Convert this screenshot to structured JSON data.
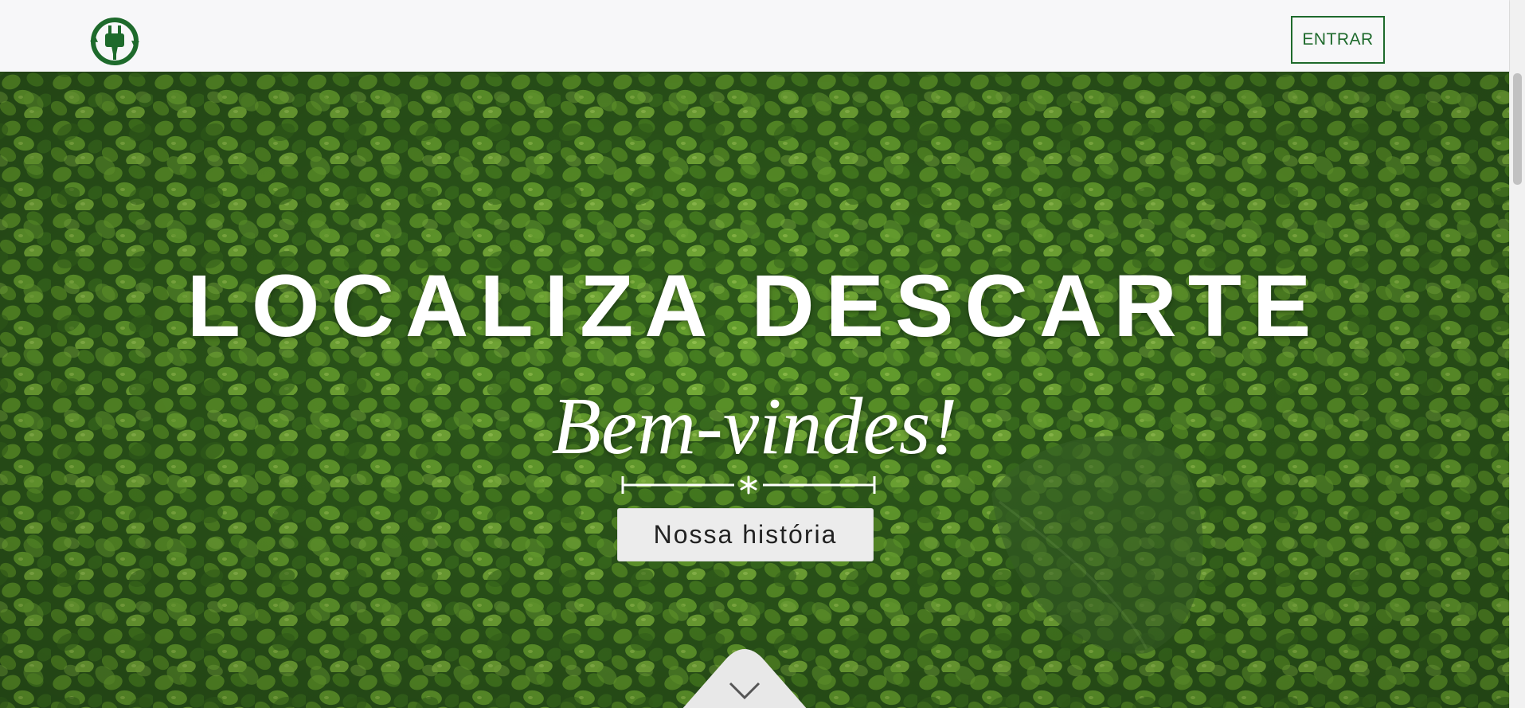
{
  "header": {
    "logo_icon": "plug-recycle-icon",
    "login_label": "ENTRAR"
  },
  "hero": {
    "title": "LOCALIZA DESCARTE",
    "subtitle": "Bem-vindes!",
    "story_button_label": "Nossa história",
    "scroll_icon": "chevron-down-icon",
    "divider_icon": "asterisk-divider-icon"
  },
  "colors": {
    "brand_green": "#1e6a2c",
    "header_bg": "#f7f7f9",
    "button_bg": "#ececec",
    "hero_text": "#ffffff"
  }
}
